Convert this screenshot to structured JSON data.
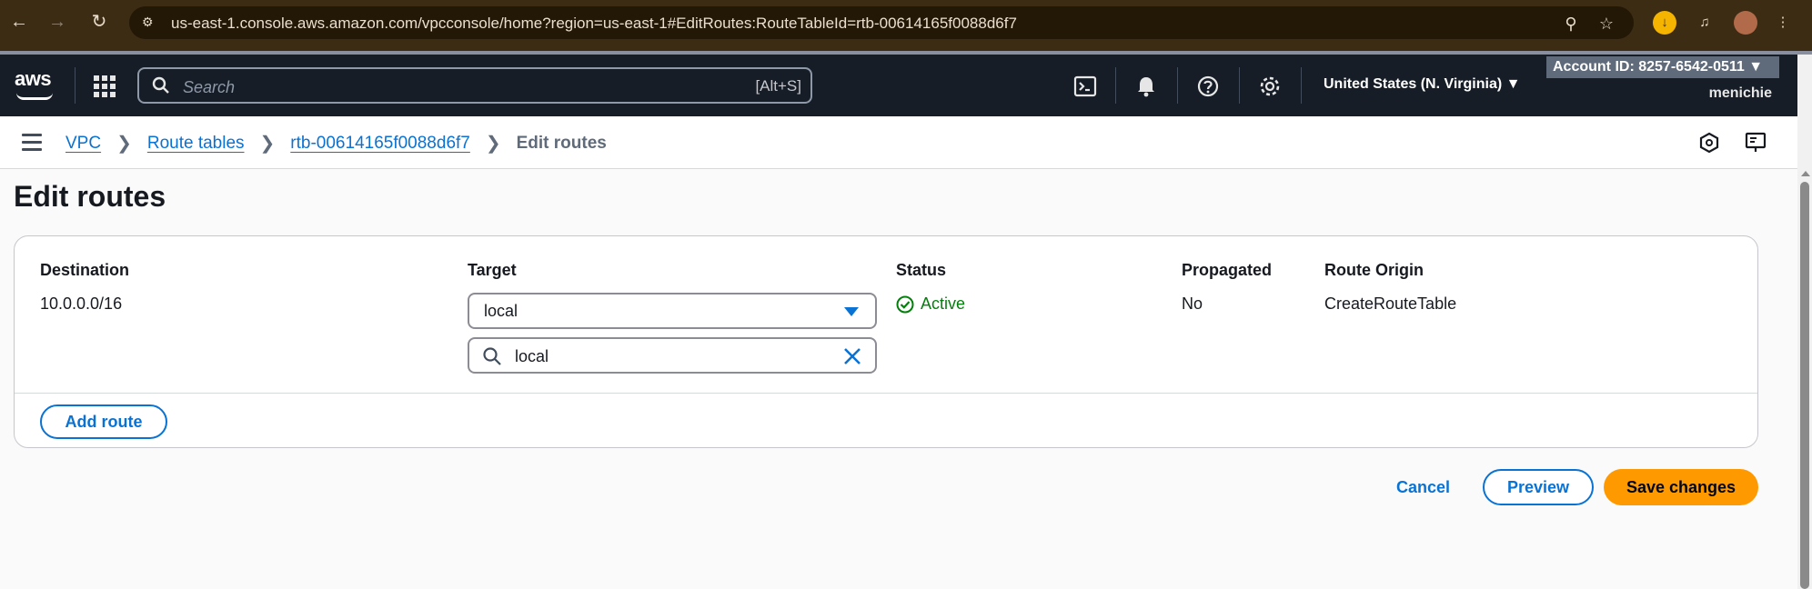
{
  "browser": {
    "url": "us-east-1.console.aws.amazon.com/vpcconsole/home?region=us-east-1#EditRoutes:RouteTableId=rtb-00614165f0088d6f7",
    "icons": [
      "back-icon",
      "forward-icon",
      "reload-icon",
      "site-info-icon",
      "zoom-icon",
      "bookmark-star-icon",
      "download-icon",
      "media-control-icon",
      "profile-avatar",
      "browser-menu-icon"
    ]
  },
  "awsnav": {
    "logo": "aws",
    "search_placeholder": "Search",
    "search_shortcut": "[Alt+S]",
    "region": "United States (N. Virginia) ▼",
    "account": "Account ID: 8257-6542-0511 ▼",
    "username": "menichie"
  },
  "breadcrumb": {
    "items": [
      "VPC",
      "Route tables",
      "rtb-00614165f0088d6f7"
    ],
    "current": "Edit routes"
  },
  "page": {
    "title": "Edit routes"
  },
  "routes": {
    "headers": {
      "destination": "Destination",
      "target": "Target",
      "status": "Status",
      "propagated": "Propagated",
      "origin": "Route Origin"
    },
    "row": {
      "destination": "10.0.0.0/16",
      "target": "local",
      "target_filter": "local",
      "status": "Active",
      "propagated": "No",
      "origin": "CreateRouteTable"
    },
    "add_route_label": "Add route"
  },
  "actions": {
    "cancel": "Cancel",
    "preview": "Preview",
    "save": "Save changes"
  },
  "colors": {
    "link": "#0972d3",
    "success": "#037f0c",
    "primary_button": "#ff9900",
    "nav_bg": "#161d26"
  }
}
